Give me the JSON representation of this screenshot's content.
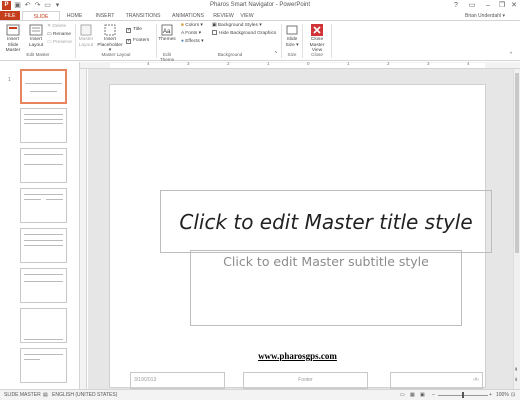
{
  "window": {
    "title": "Pharos Smart Navigator - PowerPoint",
    "help": "?",
    "minimize": "–",
    "restore": "❐",
    "close": "✕"
  },
  "tabs": {
    "file": "FILE",
    "slide_master": "SLIDE MASTER",
    "home": "HOME",
    "insert": "INSERT",
    "transitions": "TRANSITIONS",
    "animations": "ANIMATIONS",
    "review": "REVIEW",
    "view": "VIEW",
    "user": "Brian Underdahl ▾"
  },
  "ribbon": {
    "edit_master": {
      "insert_slide_master": "Insert Slide Master",
      "insert_layout": "Insert Layout",
      "delete": "Delete",
      "rename": "Rename",
      "preserve": "Preserve",
      "group_label": "Edit Master"
    },
    "master_layout": {
      "master_layout": "Master Layout",
      "insert_placeholder": "Insert Placeholder ▾",
      "title": "Title",
      "footers": "Footers",
      "group_label": "Master Layout"
    },
    "edit_theme": {
      "themes": "Themes",
      "group_label": "Edit Theme"
    },
    "background": {
      "colors": "Colors ▾",
      "fonts": "Fonts ▾",
      "effects": "Effects ▾",
      "background_styles": "Background Styles ▾",
      "hide_background_graphics": "Hide Background Graphics",
      "group_label": "Background"
    },
    "size": {
      "slide_size": "Slide Size ▾",
      "group_label": "Size"
    },
    "close": {
      "close_master_view": "Close Master View",
      "group_label": "Close"
    }
  },
  "thumbnails": {
    "master_number": "1"
  },
  "ruler": {
    "h_ticks": [
      "4",
      "3",
      "2",
      "1",
      "0",
      "1",
      "2",
      "3",
      "4"
    ]
  },
  "slide": {
    "title_placeholder": "Click to edit Master title style",
    "subtitle_placeholder": "Click to edit Master subtitle style",
    "url": "www.pharosgps.com",
    "date": "3/19/2013",
    "footer": "Footer",
    "page_number": "‹#›"
  },
  "status": {
    "view": "SLIDE MASTER",
    "language": "ENGLISH (UNITED STATES)",
    "zoom": "100%"
  },
  "colors": {
    "accent": "#c43e1c",
    "selection": "#e8855f",
    "close_icon": "#d13438"
  }
}
